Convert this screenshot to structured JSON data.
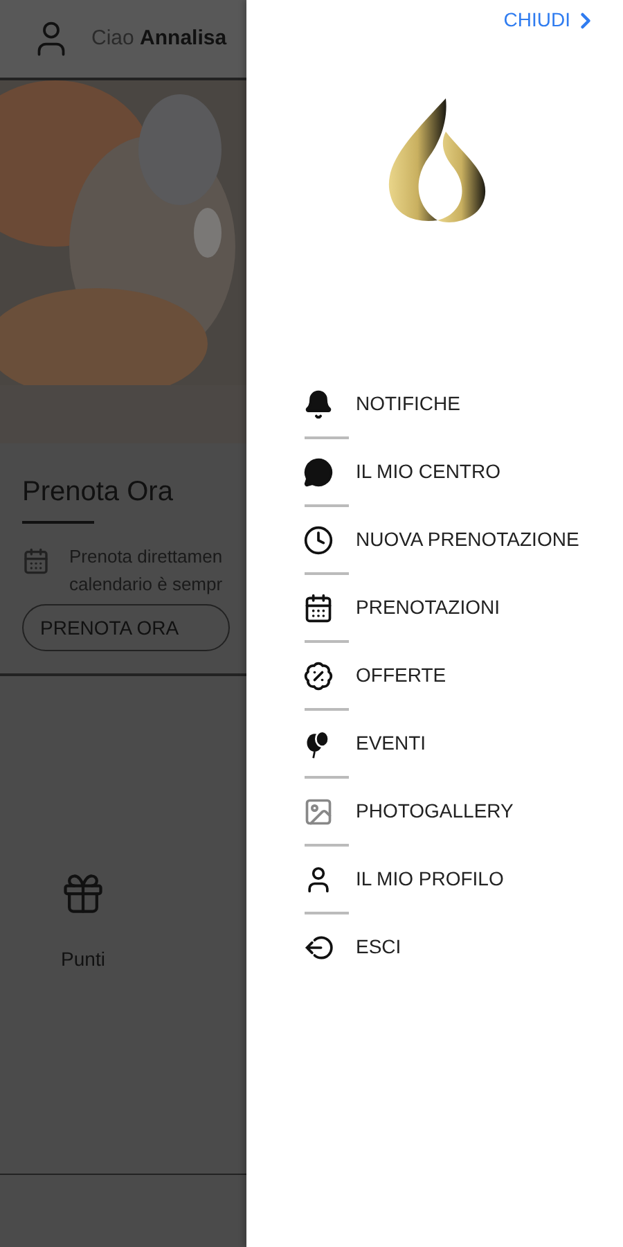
{
  "background_app": {
    "greeting": "Ciao **Annalisa**",
    "section_title": "Prenota Ora",
    "description_lines": [
      "Prenota direttamen",
      "calendario è sempr"
    ],
    "book_button": "PRENOTA ORA",
    "shortcut": {
      "label": "Punti"
    }
  },
  "drawer": {
    "close_button": "CHIUDI",
    "menu_items": [
      {
        "label": "NOTIFICHE"
      },
      {
        "label": "IL MIO CENTRO"
      },
      {
        "label": "NUOVA PRENOTAZIONE"
      },
      {
        "label": "PRENOTAZIONI"
      },
      {
        "label": "OFFERTE"
      },
      {
        "label": "EVENTI"
      },
      {
        "label": "PHOTOGALLERY"
      },
      {
        "label": "IL MIO PROFILO"
      },
      {
        "label": "ESCI"
      }
    ]
  }
}
